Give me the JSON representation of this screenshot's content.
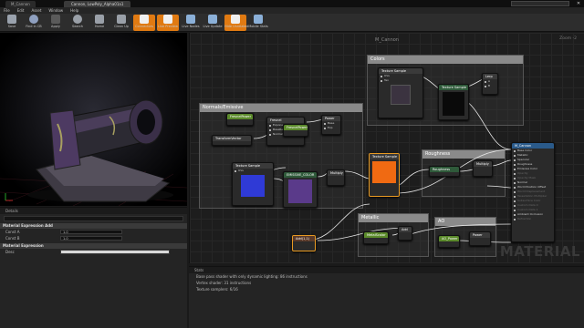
{
  "window": {
    "doc_tab": "M_Cannon",
    "material_tab": "Cannon, LowPoly_Alpha01a1",
    "close_glyph": "✕"
  },
  "menu": [
    "File",
    "Edit",
    "Asset",
    "Window",
    "Help"
  ],
  "toolbar": [
    {
      "label": "Save",
      "color": "#9aa2ad"
    },
    {
      "label": "Find in CB",
      "color": "#8fa0c0"
    },
    {
      "label": "Apply",
      "color": "#6a6a6a"
    },
    {
      "label": "Search",
      "color": "#9aa0a8"
    },
    {
      "label": "Home",
      "color": "#9aa0a8"
    },
    {
      "label": "Clean Up",
      "color": "#9aa0a8"
    },
    {
      "label": "Connectors",
      "color": "#f0f0f0"
    },
    {
      "label": "Live Preview",
      "color": "#f0f0f0"
    },
    {
      "label": "Live Nodes",
      "color": "#8bb0d8"
    },
    {
      "label": "Live Update",
      "color": "#8bb0d8"
    },
    {
      "label": "Hide Unrelated",
      "color": "#f0f0f0"
    },
    {
      "label": "Mobile Stats",
      "color": "#8bb0d8"
    }
  ],
  "details": {
    "panel_title": "Details",
    "section1": "Material Expression Add",
    "rows1": [
      {
        "key": "Const A",
        "value": "1.0"
      },
      {
        "key": "Const B",
        "value": "1.0"
      }
    ],
    "section2": "Material Expression",
    "rows2": [
      {
        "key": "Desc",
        "value": ""
      }
    ]
  },
  "graph": {
    "title": "M_Cannon",
    "zoom": "Zoom -2",
    "watermark": "MATERIAL",
    "comments": {
      "colors": "Colors",
      "normals": "Normals/Emissive",
      "roughness": "Roughness",
      "metallic": "Metallic",
      "ao": "AO"
    },
    "nodes": {
      "tex_colors": "Texture Sample",
      "lerp": "Lerp",
      "tex_param": "Texture Sample",
      "fresnel": "Fresnel",
      "param_fresnel": "FresnelPower",
      "transform": "TransformVector",
      "tex_normal": "Texture Sample",
      "emissive_color": "EMISSIVE_COLOR",
      "power": "Power",
      "multiply_a": "Multiply",
      "tex_rough": "Texture Sample",
      "rough_mult": "Roughness",
      "multiply_b": "Multiply",
      "metal_val": "MetalScalar",
      "add_small": "Add",
      "ao_power": "AO_Power",
      "power_b": "Power",
      "add_node": "Add(1,1)",
      "result": "M_Cannon",
      "pins_tex": [
        "UVs",
        "Tex"
      ],
      "pins_lerp": [
        "A",
        "B",
        "Alpha"
      ],
      "pins_fresnel": [
        "ExponentIn",
        "BaseReflectFractionIn",
        "Normal"
      ],
      "pins_power": [
        "Base",
        "Exp"
      ],
      "result_pins": [
        "Base Color",
        "Metallic",
        "Specular",
        "Roughness",
        "Emissive Color",
        "Opacity",
        "Opacity Mask",
        "Normal",
        "World Position Offset",
        "World Displacement",
        "Tessellation Multiplier",
        "Subsurface Color",
        "Custom Data 0",
        "Custom Data 1",
        "Ambient Occlusion",
        "Refraction"
      ]
    }
  },
  "stats": {
    "panel_title": "Stats",
    "lines": [
      "Base pass shader with only dynamic lighting: 86 instructions",
      "Vertex shader: 31 instructions",
      "Texture samplers: 6/16"
    ]
  }
}
